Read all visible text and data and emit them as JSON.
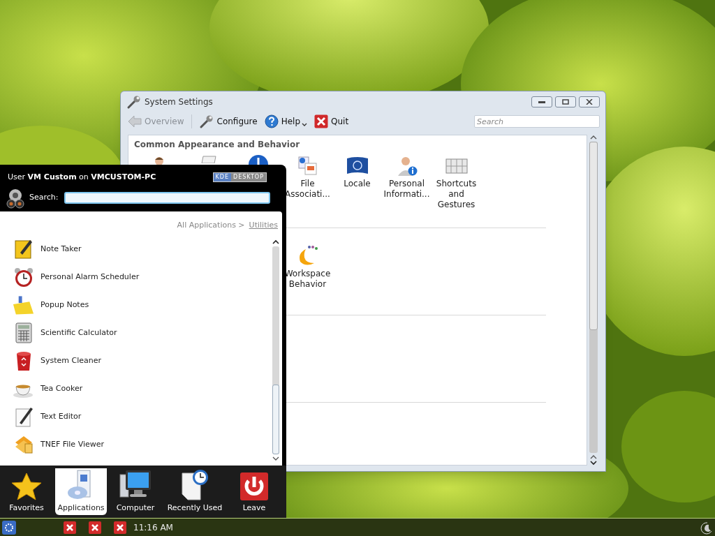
{
  "settings_window": {
    "title": "System Settings",
    "toolbar": [
      {
        "kind": "back",
        "label": "Overview",
        "disabled": true
      },
      {
        "kind": "wrench",
        "label": "Configure",
        "disabled": false
      },
      {
        "kind": "help",
        "label": "Help",
        "disabled": false
      },
      {
        "kind": "quit",
        "label": "Quit",
        "disabled": false
      }
    ],
    "search": {
      "placeholder": "Search"
    },
    "section_title": "Common Appearance and Behavior",
    "modules_row_1": [
      {
        "kind": "person"
      },
      {
        "kind": "paper"
      },
      {
        "kind": "blue"
      },
      {
        "kind": "files",
        "label": "File Associati..."
      },
      {
        "kind": "flag",
        "label": "Locale"
      },
      {
        "kind": "personinfo",
        "label": "Personal Informati..."
      },
      {
        "kind": "keys",
        "label": "Shortcuts and Gestures"
      }
    ],
    "modules_row_2": [
      {
        "kind": "workspace",
        "label": "Workspace Behavior"
      }
    ]
  },
  "launcher": {
    "user_line": "User **VM Custom** on **VMCUSTOM-PC**",
    "badge": [
      "KDE",
      "DESKTOP"
    ],
    "search_label": "Search:",
    "breadcrumb": [
      "All Applications >",
      "Utilities"
    ],
    "apps": [
      {
        "kind": "note",
        "label": "Note Taker"
      },
      {
        "kind": "alarm",
        "label": "Personal Alarm Scheduler"
      },
      {
        "kind": "popup",
        "label": "Popup Notes"
      },
      {
        "kind": "calc",
        "label": "Scientific Calculator"
      },
      {
        "kind": "cleaner",
        "label": "System Cleaner"
      },
      {
        "kind": "tea",
        "label": "Tea Cooker"
      },
      {
        "kind": "editor",
        "label": "Text Editor"
      },
      {
        "kind": "tnef",
        "label": "TNEF File Viewer"
      }
    ],
    "tabs": [
      {
        "kind": "star",
        "label": "Favorites",
        "selected": false
      },
      {
        "kind": "apps",
        "label": "Applications",
        "selected": true
      },
      {
        "kind": "computer",
        "label": "Computer",
        "selected": false
      },
      {
        "kind": "recent",
        "label": "Recently Used",
        "selected": false
      },
      {
        "kind": "leave",
        "label": "Leave",
        "selected": false
      }
    ]
  },
  "taskbar": {
    "tasks": [
      {
        "kind": "error"
      },
      {
        "kind": "error"
      },
      {
        "kind": "error"
      }
    ],
    "clock": "11:16 AM"
  }
}
